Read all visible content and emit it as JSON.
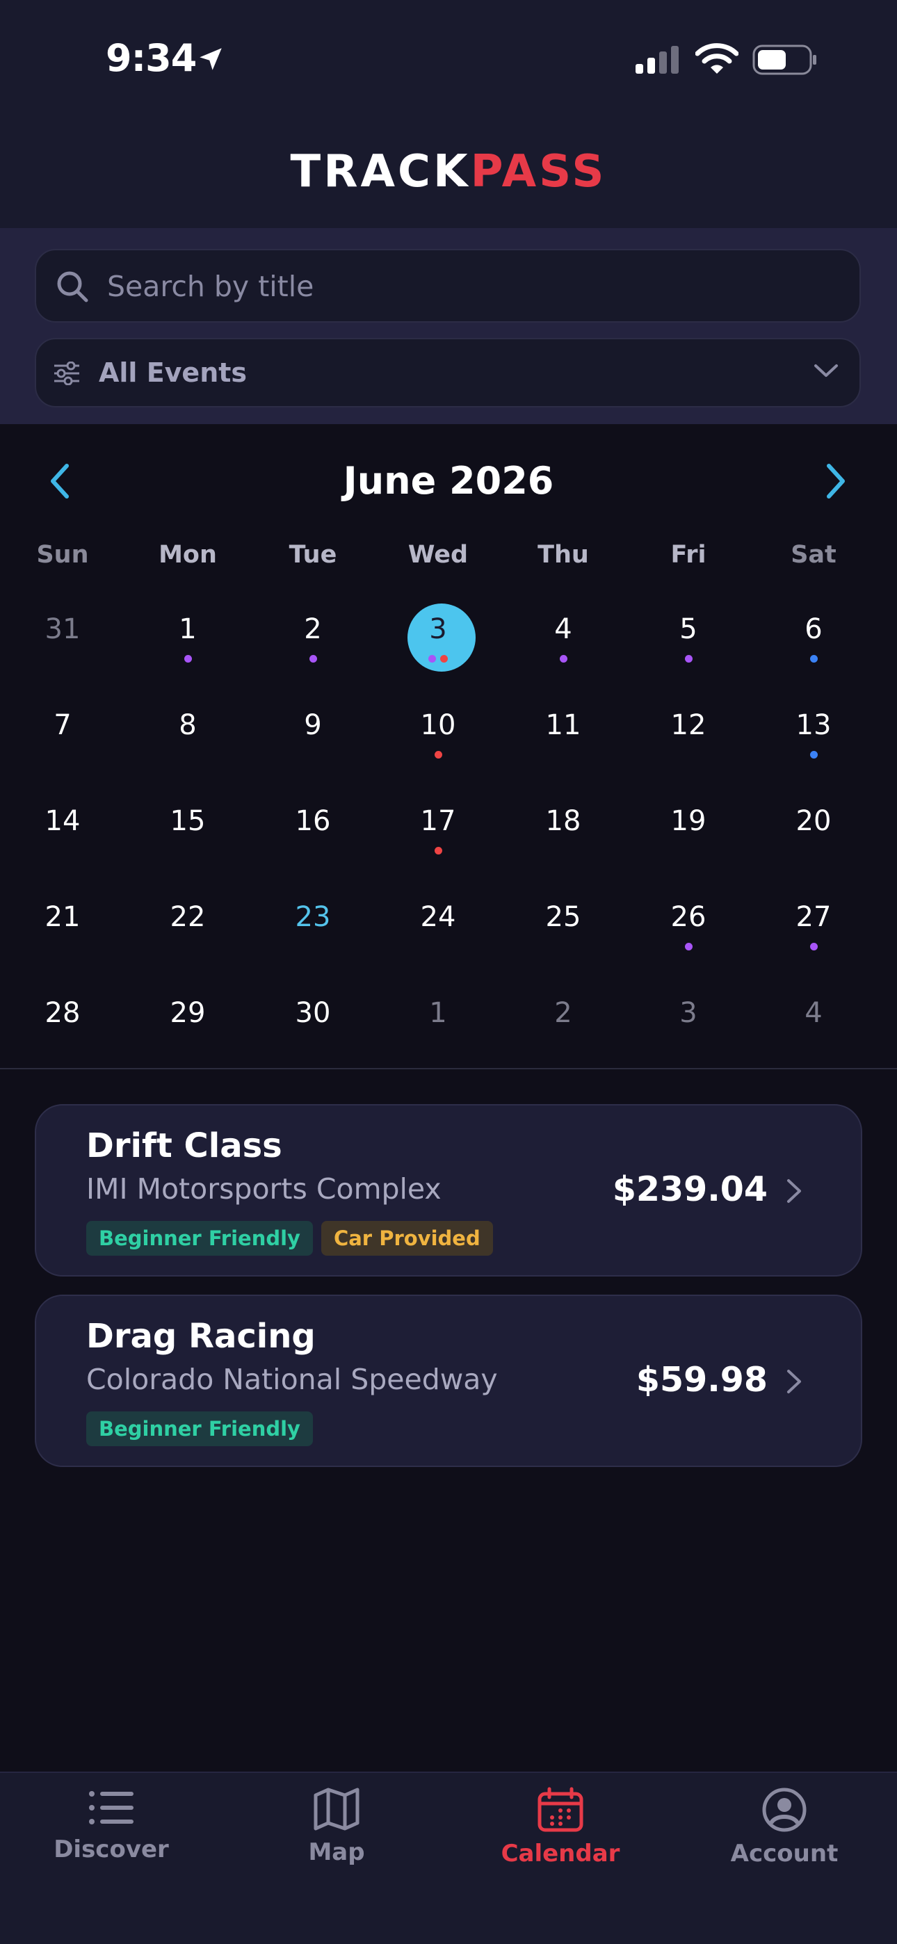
{
  "status_bar": {
    "time": "9:34"
  },
  "header": {
    "logo_part1": "TRACK",
    "logo_part2": "PASS"
  },
  "search": {
    "placeholder": "Search by title"
  },
  "filter": {
    "selected": "All Events"
  },
  "calendar": {
    "month_label": "June 2026",
    "weekdays": [
      "Sun",
      "Mon",
      "Tue",
      "Wed",
      "Thu",
      "Fri",
      "Sat"
    ],
    "weeks": [
      [
        {
          "day": "31",
          "muted": true,
          "dots": []
        },
        {
          "day": "1",
          "dots": [
            "purple"
          ]
        },
        {
          "day": "2",
          "dots": [
            "purple"
          ]
        },
        {
          "day": "3",
          "selected": true,
          "dots": [
            "purple",
            "red"
          ]
        },
        {
          "day": "4",
          "dots": [
            "purple"
          ]
        },
        {
          "day": "5",
          "dots": [
            "purple"
          ]
        },
        {
          "day": "6",
          "dots": [
            "blue"
          ]
        }
      ],
      [
        {
          "day": "7",
          "dots": []
        },
        {
          "day": "8",
          "dots": []
        },
        {
          "day": "9",
          "dots": []
        },
        {
          "day": "10",
          "dots": [
            "red"
          ]
        },
        {
          "day": "11",
          "dots": []
        },
        {
          "day": "12",
          "dots": []
        },
        {
          "day": "13",
          "dots": [
            "blue"
          ]
        }
      ],
      [
        {
          "day": "14",
          "dots": []
        },
        {
          "day": "15",
          "dots": []
        },
        {
          "day": "16",
          "dots": []
        },
        {
          "day": "17",
          "dots": [
            "red"
          ]
        },
        {
          "day": "18",
          "dots": []
        },
        {
          "day": "19",
          "dots": []
        },
        {
          "day": "20",
          "dots": []
        }
      ],
      [
        {
          "day": "21",
          "dots": []
        },
        {
          "day": "22",
          "dots": []
        },
        {
          "day": "23",
          "today": true,
          "dots": []
        },
        {
          "day": "24",
          "dots": []
        },
        {
          "day": "25",
          "dots": []
        },
        {
          "day": "26",
          "dots": [
            "purple"
          ]
        },
        {
          "day": "27",
          "dots": [
            "purple"
          ]
        }
      ],
      [
        {
          "day": "28",
          "dots": []
        },
        {
          "day": "29",
          "dots": []
        },
        {
          "day": "30",
          "dots": []
        },
        {
          "day": "1",
          "muted": true,
          "dots": []
        },
        {
          "day": "2",
          "muted": true,
          "dots": []
        },
        {
          "day": "3",
          "muted": true,
          "dots": []
        },
        {
          "day": "4",
          "muted": true,
          "dots": []
        }
      ]
    ],
    "dot_colors": {
      "purple": "#a855f7",
      "red": "#ef4444",
      "blue": "#3b82f6"
    }
  },
  "events": [
    {
      "title": "Drift Class",
      "venue": "IMI Motorsports Complex",
      "price": "$239.04",
      "tags": [
        {
          "label": "Beginner Friendly",
          "style": "green"
        },
        {
          "label": "Car Provided",
          "style": "amber"
        }
      ]
    },
    {
      "title": "Drag Racing",
      "venue": "Colorado National Speedway",
      "price": "$59.98",
      "tags": [
        {
          "label": "Beginner Friendly",
          "style": "green"
        }
      ]
    }
  ],
  "tabbar": {
    "items": [
      {
        "label": "Discover",
        "icon": "list-icon"
      },
      {
        "label": "Map",
        "icon": "map-icon"
      },
      {
        "label": "Calendar",
        "icon": "calendar-icon",
        "active": true
      },
      {
        "label": "Account",
        "icon": "account-icon"
      }
    ]
  },
  "colors": {
    "accent": "#e73a48",
    "selected_day": "#4cc5ee",
    "today": "#54c3eb"
  }
}
